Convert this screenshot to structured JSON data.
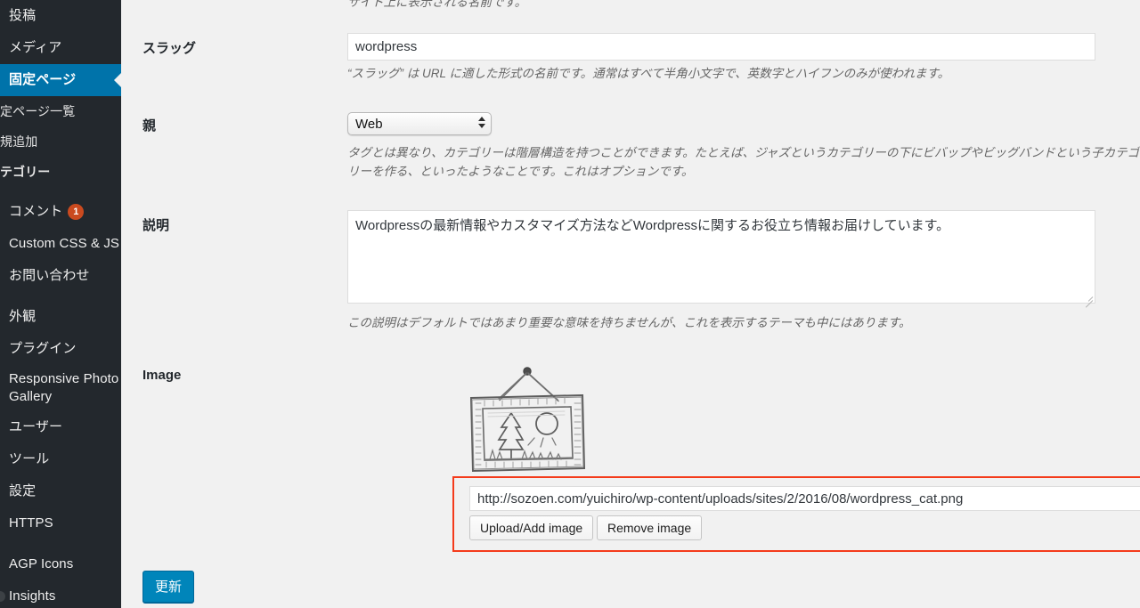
{
  "sidebar": {
    "items": [
      {
        "label": "投稿",
        "type": "top",
        "active": false
      },
      {
        "label": "メディア",
        "type": "top",
        "active": false
      },
      {
        "label": "固定ページ",
        "type": "top",
        "active": true
      },
      {
        "label": "定ページ一覧",
        "type": "sub",
        "active": false
      },
      {
        "label": "規追加",
        "type": "sub",
        "active": false
      },
      {
        "label": "テゴリー",
        "type": "sub",
        "bold": true,
        "active": false
      },
      {
        "label": "コメント",
        "type": "top",
        "badge": "1",
        "active": false
      },
      {
        "label": "Custom CSS & JS",
        "type": "top",
        "active": false
      },
      {
        "label": "お問い合わせ",
        "type": "top",
        "active": false
      },
      {
        "label": "外観",
        "type": "top",
        "active": false
      },
      {
        "label": "プラグイン",
        "type": "top",
        "active": false
      },
      {
        "label": "Responsive Photo Gallery",
        "type": "top-2",
        "active": false
      },
      {
        "label": "ユーザー",
        "type": "top",
        "active": false
      },
      {
        "label": "ツール",
        "type": "top",
        "active": false
      },
      {
        "label": "設定",
        "type": "top",
        "active": false
      },
      {
        "label": "HTTPS",
        "type": "top",
        "active": false
      },
      {
        "label": "AGP Icons",
        "type": "top",
        "active": false
      },
      {
        "label": "Insights",
        "type": "top",
        "active": false
      }
    ],
    "colors": {
      "background": "#23282d",
      "active": "#0073aa",
      "badge": "#ca4a1f",
      "text": "#eeeeee"
    }
  },
  "form": {
    "clipped_top_help": "サイト上に表示される名前です。",
    "slug": {
      "label": "スラッグ",
      "value": "wordpress",
      "placeholder": "",
      "help": "“スラッグ” は URL に適した形式の名前です。通常はすべて半角小文字で、英数字とハイフンのみが使われます。"
    },
    "parent": {
      "label": "親",
      "selected": "Web",
      "options": [
        "Web"
      ],
      "help": "タグとは異なり、カテゴリーは階層構造を持つことができます。たとえば、ジャズというカテゴリーの下にビバップやビッグバンドという子カテゴリーを作る、といったようなことです。これはオプションです。"
    },
    "description": {
      "label": "説明",
      "value": "Wordpressの最新情報やカスタマイズ方法などWordpressに関するお役立ち情報お届けしています。",
      "placeholder": "",
      "help": "この説明はデフォルトではあまり重要な意味を持ちませんが、これを表示するテーマも中にはあります。"
    },
    "image": {
      "label": "Image",
      "url_value": "http://sozoen.com/yuichiro/wp-content/uploads/sites/2/2016/08/wordpress_cat.png",
      "url_placeholder": "",
      "upload_button": "Upload/Add image",
      "remove_button": "Remove image",
      "highlight_color": "#f43b1b",
      "thumbnail_alt": "framed-picture-sketch"
    },
    "submit": {
      "label": "更新",
      "color": "#0085ba"
    }
  }
}
